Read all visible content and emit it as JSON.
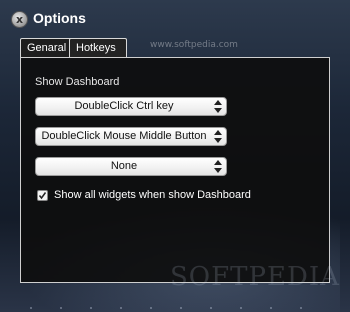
{
  "window": {
    "title": "Options",
    "close_icon": "x"
  },
  "watermark": {
    "small": "www.softpedia.com",
    "large": "SOFTPEDIA"
  },
  "tabs": [
    {
      "label": "Genaral",
      "active": false
    },
    {
      "label": "Hotkeys",
      "active": true
    }
  ],
  "hotkeys": {
    "section_label": "Show Dashboard",
    "dropdowns": [
      {
        "value": "DoubleClick Ctrl key"
      },
      {
        "value": "DoubleClick Mouse Middle  Button"
      },
      {
        "value": "None"
      }
    ],
    "checkbox": {
      "label": "Show all widgets when show Dashboard",
      "checked": true
    }
  },
  "colors": {
    "panel_bg": "#0e0e0e",
    "panel_border": "#cfcfcf",
    "text": "#ffffff"
  }
}
